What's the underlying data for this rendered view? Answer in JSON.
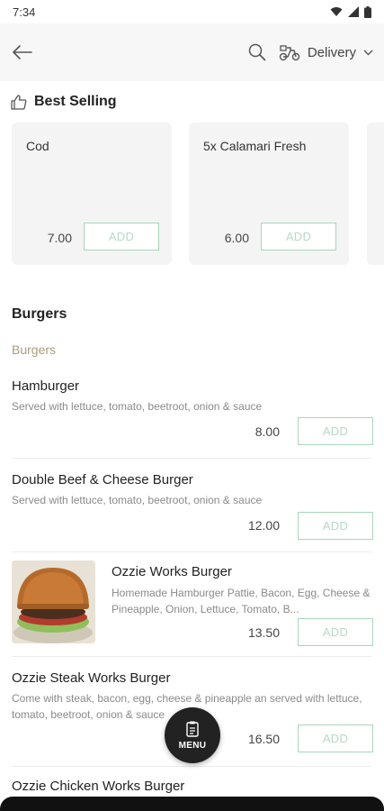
{
  "status_bar": {
    "time": "7:34"
  },
  "header": {
    "delivery_label": "Delivery"
  },
  "best_selling": {
    "title": "Best Selling",
    "items": [
      {
        "name": "Cod",
        "price": "7.00",
        "add_label": "ADD"
      },
      {
        "name": "5x Calamari  Fresh",
        "price": "6.00",
        "add_label": "ADD"
      }
    ]
  },
  "category": {
    "title": "Burgers",
    "subcategory": "Burgers",
    "items": [
      {
        "name": "Hamburger",
        "description": "Served with lettuce, tomato, beetroot, onion & sauce",
        "price": "8.00",
        "add_label": "ADD"
      },
      {
        "name": "Double Beef & Cheese Burger",
        "description": "Served with lettuce, tomato, beetroot, onion & sauce",
        "price": "12.00",
        "add_label": "ADD"
      },
      {
        "name": "Ozzie Works Burger",
        "description": "Homemade Hamburger Pattie, Bacon, Egg, Cheese & Pineapple, Onion, Lettuce, Tomato, B...",
        "price": "13.50",
        "add_label": "ADD"
      },
      {
        "name": "Ozzie Steak Works Burger",
        "description": "Come with steak, bacon, egg, cheese & pineapple an served with lettuce, tomato, beetroot, onion & sauce",
        "price": "16.50",
        "add_label": "ADD"
      },
      {
        "name": "Ozzie Chicken Works Burger"
      }
    ]
  },
  "menu_fab": {
    "label": "MENU"
  },
  "colors": {
    "accent_green": "#a9d5bb",
    "subcategory_tan": "#a89e7c",
    "fab_bg": "#222222"
  }
}
